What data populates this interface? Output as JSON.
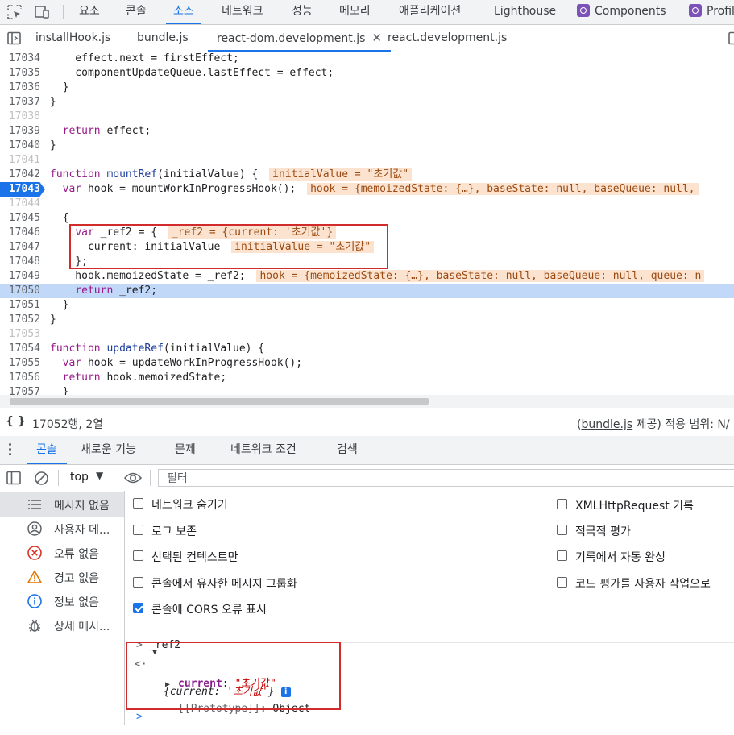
{
  "main_tabs": [
    "요소",
    "콘솔",
    "소스",
    "네트워크",
    "성능",
    "메모리",
    "애플리케이션",
    "Lighthouse",
    "Components",
    "Profil"
  ],
  "active_main_tab": "소스",
  "file_tabs": [
    "installHook.js",
    "bundle.js",
    "react-dom.development.js",
    "react.development.js"
  ],
  "active_file_tab": "react-dom.development.js",
  "code": {
    "line_numbers": [
      "17034",
      "17035",
      "17036",
      "17037",
      "17038",
      "17039",
      "17040",
      "17041",
      "17042",
      "17043",
      "17044",
      "17045",
      "17046",
      "17047",
      "17048",
      "17049",
      "17050",
      "17051",
      "17052",
      "17053",
      "17054",
      "17055",
      "17056",
      "17057"
    ],
    "l17034": "    effect.next = firstEffect;",
    "l17035": "    componentUpdateQueue.lastEffect = effect;",
    "l17036": "  }",
    "l17037": "}",
    "l17039_kw": "return",
    "l17039_rest": " effect;",
    "l17040": "}",
    "l17042_kw": "function",
    "l17042_fn": "mountRef",
    "l17042_rest": "(initialValue) {",
    "l17042_inline": "initialValue = \"초기값\"",
    "l17043_kw": "var",
    "l17043_rest": " hook = mountWorkInProgressHook();",
    "l17043_inline": "hook = {memoizedState: {…}, baseState: null, baseQueue: null,",
    "l17045": "  {",
    "l17046_kw": "var",
    "l17046_rest": " _ref2 = {",
    "l17046_inline": "_ref2 = {current: '초기값'}",
    "l17047": "      current: initialValue",
    "l17047_inline": "initialValue = \"초기값\"",
    "l17048": "    };",
    "l17049": "    hook.memoizedState = _ref2;",
    "l17049_inline": "hook = {memoizedState: {…}, baseState: null, baseQueue: null, queue: n",
    "l17050_kw": "return",
    "l17050_rest": " _ref2;",
    "l17051": "  }",
    "l17052": "}",
    "l17054_kw": "function",
    "l17054_fn": "updateRef",
    "l17054_rest": "(initialValue) {",
    "l17055_kw": "var",
    "l17055_rest": " hook = updateWorkInProgressHook();",
    "l17056_kw": "return",
    "l17056_rest": " hook.memoizedState;",
    "l17057": "  }"
  },
  "status": {
    "braces": "{ }",
    "position": "17052행, 2열",
    "source_file": "bundle.js",
    "source_prefix": "(",
    "source_suffix": " 제공) 적용 범위: N/"
  },
  "drawer_tabs": [
    "콘솔",
    "새로운 기능",
    "문제",
    "네트워크 조건",
    "검색"
  ],
  "active_drawer_tab": "콘솔",
  "console_toolbar": {
    "context": "top",
    "filter_placeholder": "필터"
  },
  "sidebar": [
    {
      "label": "메시지 없음",
      "icon": "list-icon"
    },
    {
      "label": "사용자 메...",
      "icon": "user-icon"
    },
    {
      "label": "오류 없음",
      "icon": "error-icon"
    },
    {
      "label": "경고 없음",
      "icon": "warning-icon"
    },
    {
      "label": "정보 없음",
      "icon": "info-icon"
    },
    {
      "label": "상세 메시...",
      "icon": "bug-icon"
    }
  ],
  "settings_left": [
    {
      "label": "네트워크 숨기기",
      "checked": false
    },
    {
      "label": "로그 보존",
      "checked": false
    },
    {
      "label": "선택된 컨텍스트만",
      "checked": false
    },
    {
      "label": "콘솔에서 유사한 메시지 그룹화",
      "checked": false
    },
    {
      "label": "콘솔에 CORS 오류 표시",
      "checked": true
    }
  ],
  "settings_right": [
    {
      "label": "XMLHttpRequest 기록",
      "checked": false
    },
    {
      "label": "적극적 평가",
      "checked": false
    },
    {
      "label": "기록에서 자동 완성",
      "checked": false
    },
    {
      "label": "코드 평가를 사용자 작업으로",
      "checked": false
    }
  ],
  "console": {
    "input_prompt": ">",
    "input_text": "_ref2",
    "result_prompt": "<·",
    "result_open": "{",
    "result_key": "current",
    "result_colon": ": ",
    "result_value": "'초기값'",
    "result_close": "}",
    "result_badge": "i",
    "prop_key": "current",
    "prop_colon": ": ",
    "prop_value": "\"초기값\"",
    "proto_label": "[[Prototype]]",
    "proto_value": ": Object",
    "next_prompt": ">"
  },
  "colors": {
    "accent": "#1a73e8",
    "annotation_box": "#d22b2b",
    "inline_value_bg": "#fbe3cf",
    "highlight_line": "#c2d8f8"
  }
}
